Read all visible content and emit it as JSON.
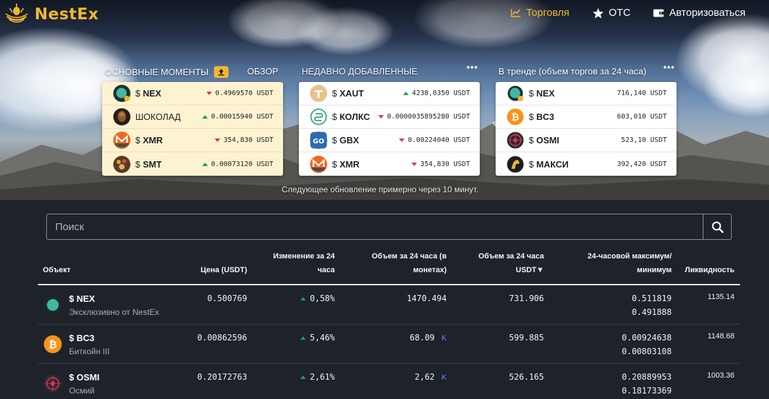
{
  "brand": {
    "name": "NestEx",
    "accent": "#f2b632"
  },
  "nav": [
    {
      "label": "Торговля",
      "icon": "chart-line-icon",
      "active": true
    },
    {
      "label": "OTC",
      "icon": "star-icon",
      "active": false
    },
    {
      "label": "Авторизоваться",
      "icon": "wallet-icon",
      "active": false
    }
  ],
  "highlights": {
    "tab_main": "ОСНОВНЫЕ МОМЕНТЫ",
    "tab_overview": "ОБЗОР",
    "more": "•••",
    "rows": [
      {
        "symbol": "$",
        "name": "NEX",
        "bold": true,
        "value": "0.4969570 USDT",
        "trend": "down"
      },
      {
        "symbol": "",
        "name": "ШОКОЛАД",
        "bold": false,
        "value": "0.00015940 USDT",
        "trend": "up"
      },
      {
        "symbol": "$",
        "name": "XMR",
        "bold": true,
        "value": "354,830 USDT",
        "trend": "down"
      },
      {
        "symbol": "$",
        "name": "SMT",
        "bold": true,
        "value": "0.00073120 USDT",
        "trend": "up"
      }
    ]
  },
  "recent": {
    "title": "НЕДАВНО ДОБАВЛЕННЫЕ",
    "more": "•••",
    "rows": [
      {
        "symbol": "$",
        "name": "XAUT",
        "value": "4238,0350 USDT",
        "trend": "up"
      },
      {
        "symbol": "$",
        "name": "КОЛКС",
        "value": "0.0000035895280 USDT",
        "trend": "down"
      },
      {
        "symbol": "$",
        "name": "GBX",
        "value": "0.00224040 USDT",
        "trend": "down"
      },
      {
        "symbol": "$",
        "name": "XMR",
        "value": "354,830 USDT",
        "trend": "down"
      }
    ]
  },
  "trending": {
    "title": "В тренде (объем торгов за 24 часа)",
    "more": "•••",
    "rows": [
      {
        "symbol": "$",
        "name": "NEX",
        "value": "716,140 USDT"
      },
      {
        "symbol": "$",
        "name": "BC3",
        "value": "603,010 USDT"
      },
      {
        "symbol": "$",
        "name": "OSMI",
        "value": "523,10 USDT"
      },
      {
        "symbol": "$",
        "name": "МАКСИ",
        "value": "392,420 USDT"
      }
    ]
  },
  "update_note": "Следующее обновление примерно через 10 минут.",
  "search": {
    "placeholder": "Поиск"
  },
  "table": {
    "headers": {
      "object": "Объект",
      "price": "Цена (USDT)",
      "change_l1": "Изменение за 24",
      "change_l2": "часа",
      "vol_coin_l1": "Объем за 24 часа (в",
      "vol_coin_l2": "монетах)",
      "vol_usdt_l1": "Объем за 24 часа",
      "vol_usdt_l2": "USDT▼",
      "hilo_l1": "24-часовой максимум/",
      "hilo_l2": "минимум",
      "liquidity": "Ликвидность"
    },
    "rows": [
      {
        "name": "$ NEX",
        "sub": "Эксклюзивно от NestEx",
        "price": "0.500769",
        "change": "0,58%",
        "vol_coin": "1470.494",
        "vol_coin_k": "",
        "vol_usdt": "731.906",
        "high": "0.511819",
        "low": "0.491888",
        "liquidity": "1135.14"
      },
      {
        "name": "$ BC3",
        "sub": "Биткойн III",
        "price": "0.00862596",
        "change": "5,46%",
        "vol_coin": "68.09",
        "vol_coin_k": "K",
        "vol_usdt": "599.885",
        "high": "0.00924638",
        "low": "0.00803108",
        "liquidity": "1148.68"
      },
      {
        "name": "$ OSMI",
        "sub": "Осмий",
        "price": "0.20172763",
        "change": "2,61%",
        "vol_coin": "2,62",
        "vol_coin_k": "K",
        "vol_usdt": "526.165",
        "high": "0.20889953",
        "low": "0.18173369",
        "liquidity": "1003.36"
      }
    ]
  }
}
